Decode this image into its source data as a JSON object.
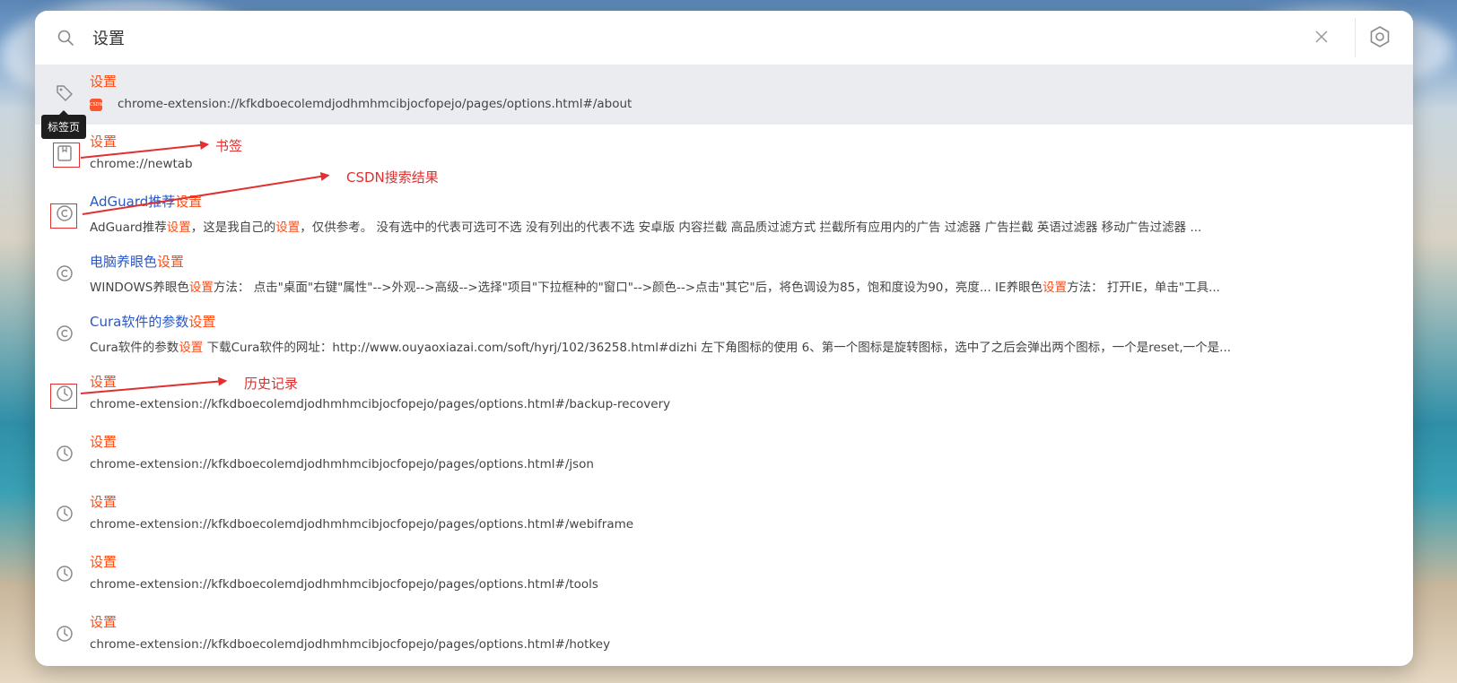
{
  "search": {
    "value": "设置",
    "placeholder": ""
  },
  "tooltip": "标签页",
  "results": [
    {
      "type": "tab",
      "icon": "tag-icon",
      "title_parts": [
        {
          "text": "设置",
          "hl": true
        }
      ],
      "subtitle": "chrome-extension://kfkdboecolemdjodhmhmcibjocfopejo/pages/options.html#/about",
      "favicon": "CSDN",
      "selected": true
    },
    {
      "type": "bookmark",
      "icon": "bookmark-icon",
      "title_parts": [
        {
          "text": "设置",
          "hl": true
        }
      ],
      "subtitle": "chrome://newtab"
    },
    {
      "type": "search",
      "icon": "copyright-icon",
      "title_parts": [
        {
          "text": "AdGuard推荐",
          "hl": false
        },
        {
          "text": "设置",
          "hl": true
        }
      ],
      "subtitle_parts": [
        {
          "text": "AdGuard推荐",
          "hl": false
        },
        {
          "text": "设置",
          "hl": true
        },
        {
          "text": "，这是我自己的",
          "hl": false
        },
        {
          "text": "设置",
          "hl": true
        },
        {
          "text": "，仅供参考。 没有选中的代表可选可不选 没有列出的代表不选 安卓版 内容拦截 高品质过滤方式 拦截所有应用内的广告 过滤器 广告拦截 英语过滤器 移动广告过滤器 ...",
          "hl": false
        }
      ]
    },
    {
      "type": "search",
      "icon": "copyright-icon",
      "title_parts": [
        {
          "text": "电脑养眼色",
          "hl": false
        },
        {
          "text": "设置",
          "hl": true
        }
      ],
      "subtitle_parts": [
        {
          "text": "WINDOWS养眼色",
          "hl": false
        },
        {
          "text": "设置",
          "hl": true
        },
        {
          "text": "方法： 点击\"桌面\"右键\"属性\"-->外观-->高级-->选择\"项目\"下拉框种的\"窗口\"-->颜色-->点击\"其它\"后，将色调设为85，饱和度设为90，亮度... IE养眼色",
          "hl": false
        },
        {
          "text": "设置",
          "hl": true
        },
        {
          "text": "方法： 打开IE，单击\"工具...",
          "hl": false
        }
      ]
    },
    {
      "type": "search",
      "icon": "copyright-icon",
      "title_parts": [
        {
          "text": "Cura软件的参数",
          "hl": false
        },
        {
          "text": "设置",
          "hl": true
        }
      ],
      "subtitle_parts": [
        {
          "text": "Cura软件的参数",
          "hl": false
        },
        {
          "text": "设置",
          "hl": true
        },
        {
          "text": " 下载Cura软件的网址：http://www.ouyaoxiazai.com/soft/hyrj/102/36258.html#dizhi 左下角图标的使用 6、第一个图标是旋转图标，选中了之后会弹出两个图标，一个是reset,一个是...",
          "hl": false
        }
      ]
    },
    {
      "type": "history",
      "icon": "clock-icon",
      "title_parts": [
        {
          "text": "设置",
          "hl": true
        }
      ],
      "subtitle": "chrome-extension://kfkdboecolemdjodhmhmcibjocfopejo/pages/options.html#/backup-recovery"
    },
    {
      "type": "history",
      "icon": "clock-icon",
      "title_parts": [
        {
          "text": "设置",
          "hl": true
        }
      ],
      "subtitle": "chrome-extension://kfkdboecolemdjodhmhmcibjocfopejo/pages/options.html#/json"
    },
    {
      "type": "history",
      "icon": "clock-icon",
      "title_parts": [
        {
          "text": "设置",
          "hl": true
        }
      ],
      "subtitle": "chrome-extension://kfkdboecolemdjodhmhmcibjocfopejo/pages/options.html#/webiframe"
    },
    {
      "type": "history",
      "icon": "clock-icon",
      "title_parts": [
        {
          "text": "设置",
          "hl": true
        }
      ],
      "subtitle": "chrome-extension://kfkdboecolemdjodhmhmcibjocfopejo/pages/options.html#/tools"
    },
    {
      "type": "history",
      "icon": "clock-icon",
      "title_parts": [
        {
          "text": "设置",
          "hl": true
        }
      ],
      "subtitle": "chrome-extension://kfkdboecolemdjodhmhmcibjocfopejo/pages/options.html#/hotkey"
    }
  ],
  "annotations": {
    "bookmark": "书签",
    "csdn": "CSDN搜索结果",
    "history": "历史记录"
  },
  "colors": {
    "highlight": "#ff4b12",
    "link": "#2a57c8",
    "annotation": "#e03030",
    "selected_row": "#ebecf0"
  }
}
